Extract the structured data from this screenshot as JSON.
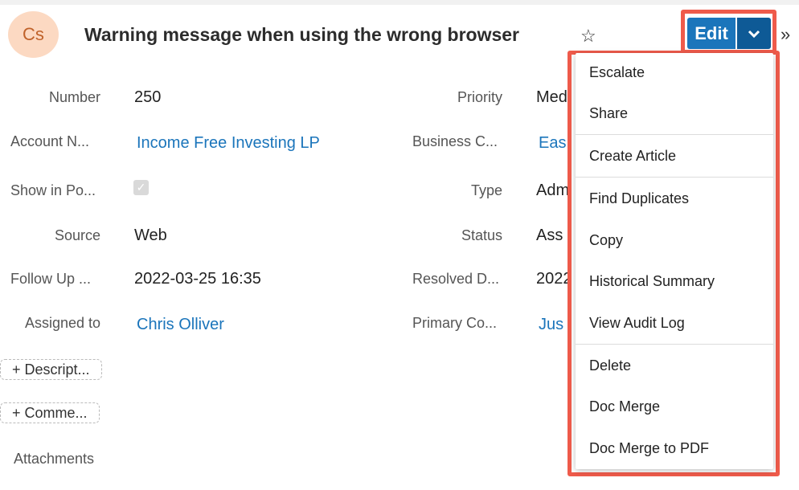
{
  "header": {
    "avatar_initials": "Cs",
    "title": "Warning message when using the wrong browser",
    "edit_label": "Edit"
  },
  "fields_left": [
    {
      "label": "Number",
      "value": "250"
    },
    {
      "label": "Account N...",
      "value": "Income Free Investing LP"
    },
    {
      "label": "Show in Po...",
      "value": ""
    },
    {
      "label": "Source",
      "value": "Web"
    },
    {
      "label": "Follow Up ...",
      "value": "2022-03-25 16:35"
    },
    {
      "label": "Assigned to",
      "value": "Chris Olliver"
    }
  ],
  "fields_right": [
    {
      "label": "Priority",
      "value": "Medi"
    },
    {
      "label": "Business C...",
      "value": "Eas"
    },
    {
      "label": "Type",
      "value": "Adm"
    },
    {
      "label": "Status",
      "value": "Ass"
    },
    {
      "label": "Resolved D...",
      "value": "2022"
    },
    {
      "label": "Primary Co...",
      "value": "Jus"
    }
  ],
  "pills": {
    "description": "+ Descript...",
    "comment": "+ Comme..."
  },
  "attachments_label": "Attachments",
  "menu": {
    "items": [
      "Escalate",
      "Share",
      "Create Article",
      "Find Duplicates",
      "Copy",
      "Historical Summary",
      "View Audit Log",
      "Delete",
      "Doc Merge",
      "Doc Merge to PDF"
    ]
  },
  "colors": {
    "accent": "#1b75bb",
    "highlight": "#ef5b4b",
    "avatar_bg": "#fcd9c2"
  },
  "icons": {
    "star": "star-icon",
    "caret": "chevron-down-icon",
    "more": "double-chevron-right-icon",
    "check": "check-icon"
  }
}
